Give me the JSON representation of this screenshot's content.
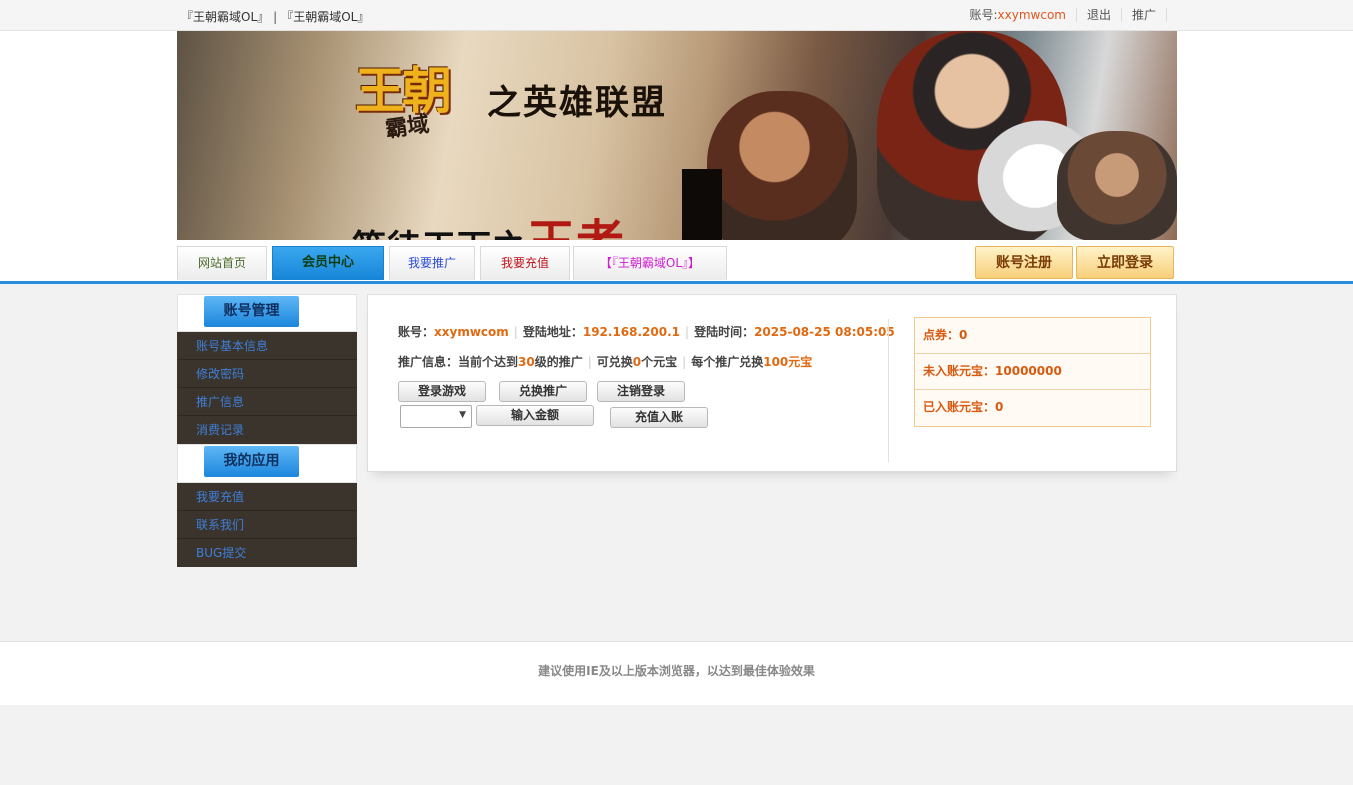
{
  "topbar": {
    "site_link_1": "『王朝霸域OL』",
    "separator": "|",
    "site_link_2": "『王朝霸域OL』",
    "account_label": "账号:",
    "account_name": "xxymwcom",
    "logout": "退出",
    "promote": "推广"
  },
  "banner": {
    "logo_main": "王朝",
    "logo_sub": "霸域",
    "slogan": "之英雄联盟",
    "bottom_text_1": "等待天下之",
    "bottom_text_2": "王者"
  },
  "nav": {
    "tabs": [
      {
        "label": "网站首页"
      },
      {
        "label": "会员中心"
      },
      {
        "label": "我要推广"
      },
      {
        "label": "我要充值"
      },
      {
        "label": "【『王朝霸域OL』】"
      }
    ],
    "register": "账号注册",
    "login": "立即登录"
  },
  "sidebar": {
    "section1": {
      "title": "账号管理",
      "items": [
        "账号基本信息",
        "修改密码",
        "推广信息",
        "消费记录"
      ]
    },
    "section2": {
      "title": "我的应用",
      "items": [
        "我要充值",
        "联系我们",
        "BUG提交"
      ]
    }
  },
  "panel": {
    "account_label": "账号：",
    "account_value": "xxymwcom",
    "ip_label": "登陆地址：",
    "ip_value": "192.168.200.1",
    "time_label": "登陆时间：",
    "time_value": "2025-08-25 08:05:05",
    "promo_prefix": "推广信息：当前个达到",
    "promo_level": "30",
    "promo_mid": "级的推广",
    "exchange_prefix": "可兑换",
    "exchange_count": "0",
    "exchange_suffix": "个元宝",
    "rate_prefix": "每个推广兑换",
    "rate_value": "100元宝",
    "buttons": {
      "login_game": "登录游戏",
      "exchange_promo": "兑换推广",
      "logout": "注销登录",
      "enter_amount": "输入金额",
      "recharge": "充值入账"
    },
    "select_value": ""
  },
  "stats": {
    "points_label": "点券：",
    "points_value": "0",
    "pending_label": "未入账元宝：",
    "pending_value": "10000000",
    "credited_label": "已入账元宝：",
    "credited_value": "0"
  },
  "footer": {
    "text": "建议使用IE及以上版本浏览器，以达到最佳体验效果"
  }
}
